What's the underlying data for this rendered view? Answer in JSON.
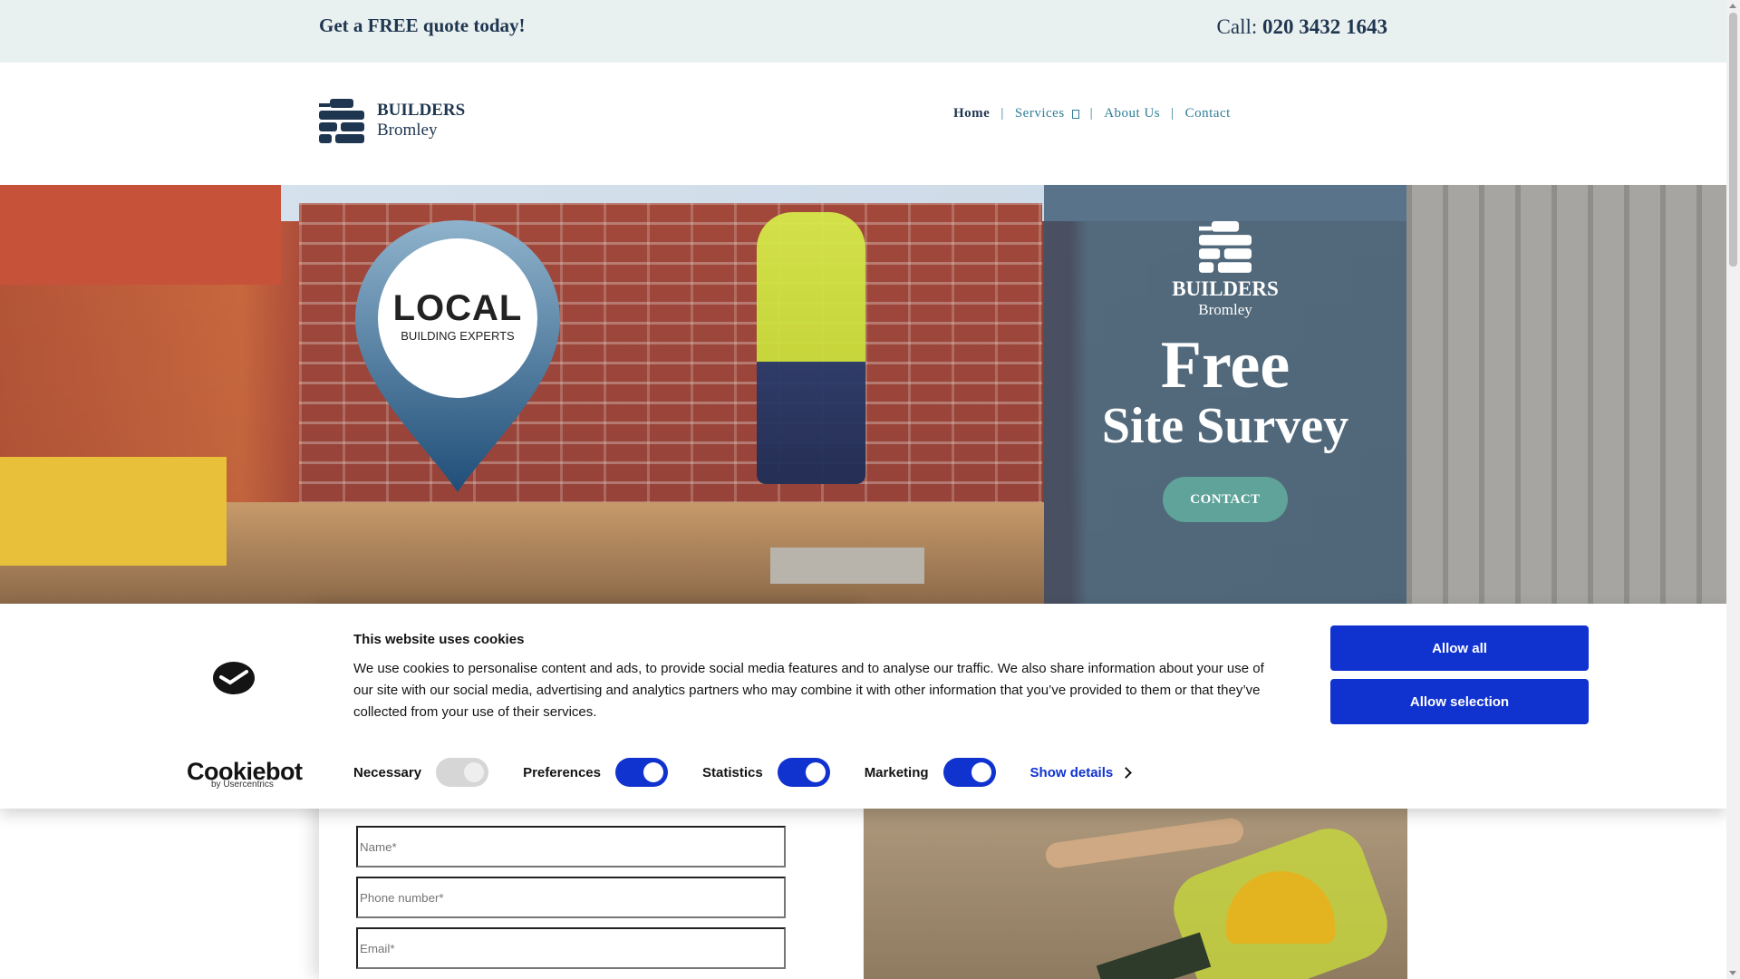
{
  "topbar": {
    "quote": "Get a FREE quote today!",
    "call_label": "Call:",
    "call_number": "020 3432 1643"
  },
  "header": {
    "logo_line1": "BUILDERS",
    "logo_line2": "Bromley",
    "nav": [
      {
        "label": "Home",
        "active": true
      },
      {
        "label": "Services"
      },
      {
        "label": "About Us"
      },
      {
        "label": "Contact"
      }
    ]
  },
  "hero": {
    "badge_line1": "LOCAL",
    "badge_line2": "BUILDING EXPERTS",
    "panel_logo_line1": "BUILDERS",
    "panel_logo_line2": "Bromley",
    "headline_line1": "Free",
    "headline_line2": "Site Survey",
    "cta_label": "CONTACT"
  },
  "form": {
    "name_placeholder": "Name*",
    "phone_placeholder": "Phone number*",
    "email_placeholder": "Email*"
  },
  "cookie": {
    "title": "This website uses cookies",
    "text": "We use cookies to personalise content and ads, to provide social media features and to analyse our traffic. We also share information about your use of our site with our social media, advertising and analytics partners who may combine it with other information that you’ve provided to them or that they’ve collected from your use of their services.",
    "brand": "Cookiebot",
    "brand_sub": "by Usercentrics",
    "toggles": [
      {
        "label": "Necessary",
        "state": "on-disabled"
      },
      {
        "label": "Preferences",
        "state": "on"
      },
      {
        "label": "Statistics",
        "state": "on"
      },
      {
        "label": "Marketing",
        "state": "on"
      }
    ],
    "show_details": "Show details",
    "allow_all": "Allow all",
    "allow_selection": "Allow selection"
  },
  "colors": {
    "brand_navy": "#1f3650",
    "accent_teal": "#5fa39a",
    "cookie_blue": "#1032cf",
    "topbar_bg": "#e9f0f0"
  }
}
